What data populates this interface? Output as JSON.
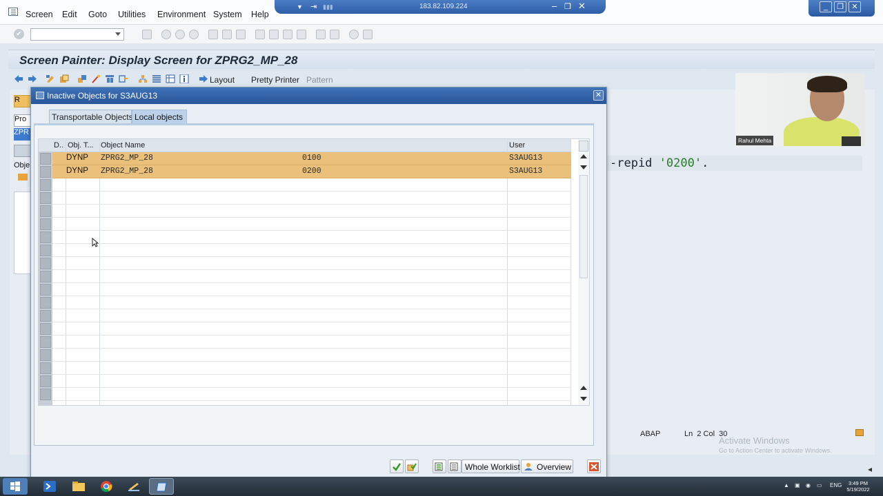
{
  "menu": {
    "items": [
      "Screen",
      "Edit",
      "Goto",
      "Utilities",
      "Environment",
      "System",
      "Help"
    ]
  },
  "remote": {
    "ip": "183.82.109.224"
  },
  "window": {
    "title": "Screen Painter: Display Screen for ZPRG2_MP_28"
  },
  "app_toolbar": {
    "layout": "Layout",
    "pretty_printer": "Pretty Printer",
    "pattern": "Pattern"
  },
  "background": {
    "left_labels": [
      "R",
      "Pro",
      "ZPR",
      "Obje"
    ],
    "code_prefix": "-repid ",
    "code_string": "'0200'",
    "code_suffix": ".",
    "status_lang": "ABAP",
    "status_pos": "Ln  2 Col  30",
    "watermark_title": "Activate Windows",
    "watermark_sub": "Go to Action Center to activate Windows."
  },
  "webcam": {
    "name": "Rahul Mehta"
  },
  "dialog": {
    "title": "Inactive Objects for S3AUG13",
    "tabs": [
      {
        "label": "Transportable Objects",
        "active": false
      },
      {
        "label": "Local objects",
        "active": true
      }
    ],
    "columns": [
      "D..",
      "Obj. T...",
      "Object Name",
      "User"
    ],
    "rows": [
      {
        "type": "DYNP",
        "name": "ZPRG2_MP_28",
        "screen": "0100",
        "user": "S3AUG13"
      },
      {
        "type": "DYNP",
        "name": "ZPRG2_MP_28",
        "screen": "0200",
        "user": "S3AUG13"
      }
    ],
    "buttons": {
      "whole_worklist": "Whole Worklist",
      "overview": "Overview"
    }
  },
  "taskbar": {
    "lang": "ENG",
    "time": "3:49 PM",
    "date": "5/19/2022"
  },
  "colors": {
    "highlight_row": "#ebc07a",
    "dialog_title": "#2a5599",
    "close_red": "#d8542f"
  }
}
